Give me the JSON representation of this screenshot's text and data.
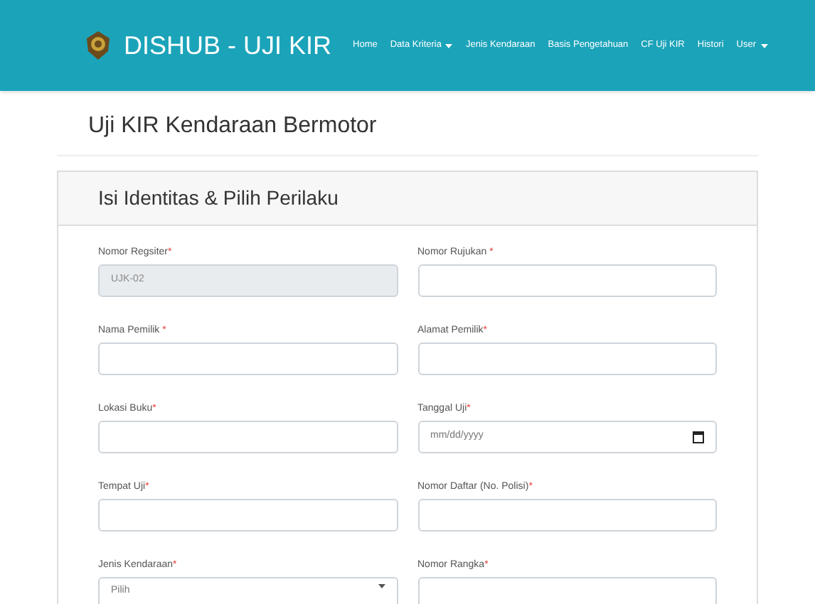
{
  "navbar": {
    "brand": "DISHUB - UJI KIR",
    "items": [
      {
        "label": "Home",
        "dropdown": false
      },
      {
        "label": "Data Kriteria",
        "dropdown": true
      },
      {
        "label": "Jenis Kendaraan",
        "dropdown": false
      },
      {
        "label": "Basis Pengetahuan",
        "dropdown": false
      },
      {
        "label": "CF Uji KIR",
        "dropdown": false
      },
      {
        "label": "Histori",
        "dropdown": false
      },
      {
        "label": "User",
        "dropdown": true
      }
    ]
  },
  "page_title": "Uji KIR Kendaraan Bermotor",
  "card": {
    "title": "Isi Identitas & Pilih Perilaku",
    "fields": [
      {
        "label": "Nomor Regsiter",
        "mark": "*",
        "kind": "text",
        "disabled": true,
        "value": "UJK-02"
      },
      {
        "label": "Nomor Rujukan ",
        "mark": "*",
        "kind": "text",
        "disabled": false
      },
      {
        "label": "Nama Pemilik ",
        "mark": "*",
        "kind": "text",
        "disabled": false
      },
      {
        "label": "Alamat Pemilik",
        "mark": "*",
        "kind": "text",
        "disabled": false
      },
      {
        "label": "Lokasi Buku",
        "mark": "*",
        "kind": "text",
        "disabled": false
      },
      {
        "label": "Tanggal Uji",
        "mark": "*",
        "kind": "date",
        "disabled": false,
        "placeholder": "mm/dd/yyyy"
      },
      {
        "label": "Tempat Uji",
        "mark": "*",
        "kind": "text",
        "disabled": false
      },
      {
        "label": "Nomor Daftar (No. Polisi)",
        "mark": "*",
        "kind": "text",
        "disabled": false
      },
      {
        "label": "Jenis Kendaraan",
        "mark": "*",
        "kind": "select",
        "disabled": false,
        "value": "Pilih"
      },
      {
        "label": "Nomor Rangka",
        "mark": "*",
        "kind": "text",
        "disabled": false
      }
    ]
  }
}
